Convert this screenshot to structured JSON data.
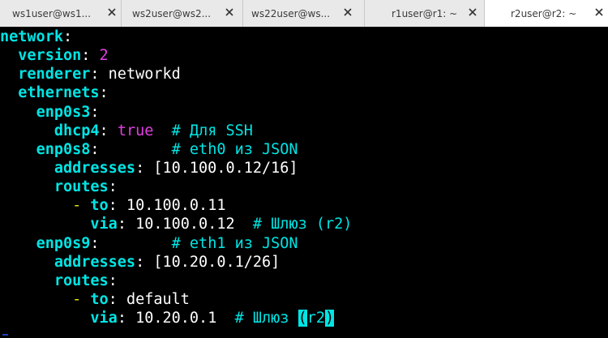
{
  "tabs": [
    {
      "label": "ws1user@ws1...",
      "close_icon": "close-icon"
    },
    {
      "label": "ws2user@ws2...",
      "close_icon": "close-icon"
    },
    {
      "label": "ws22user@ws...",
      "close_icon": "close-icon"
    },
    {
      "label": "r1user@r1: ~",
      "close_icon": "close-icon"
    },
    {
      "label": "r2user@r2: ~",
      "close_icon": "close-icon",
      "active": true
    }
  ],
  "terminal": {
    "lines": [
      [
        {
          "t": "network",
          "c": "k"
        },
        {
          "t": ":",
          "c": "p"
        }
      ],
      [
        {
          "t": "  ",
          "c": "p"
        },
        {
          "t": "version",
          "c": "k"
        },
        {
          "t": ": ",
          "c": "p"
        },
        {
          "t": "2",
          "c": "n"
        }
      ],
      [
        {
          "t": "  ",
          "c": "p"
        },
        {
          "t": "renderer",
          "c": "k"
        },
        {
          "t": ": networkd",
          "c": "p"
        }
      ],
      [
        {
          "t": "  ",
          "c": "p"
        },
        {
          "t": "ethernets",
          "c": "k"
        },
        {
          "t": ":",
          "c": "p"
        }
      ],
      [
        {
          "t": "    ",
          "c": "p"
        },
        {
          "t": "enp0s3",
          "c": "k"
        },
        {
          "t": ":",
          "c": "p"
        }
      ],
      [
        {
          "t": "      ",
          "c": "p"
        },
        {
          "t": "dhcp4",
          "c": "k"
        },
        {
          "t": ": ",
          "c": "p"
        },
        {
          "t": "true",
          "c": "n"
        },
        {
          "t": "  # Для SSH",
          "c": "c"
        }
      ],
      [
        {
          "t": "    ",
          "c": "p"
        },
        {
          "t": "enp0s8",
          "c": "k"
        },
        {
          "t": ":        ",
          "c": "p"
        },
        {
          "t": "# eth0 из JSON",
          "c": "c"
        }
      ],
      [
        {
          "t": "      ",
          "c": "p"
        },
        {
          "t": "addresses",
          "c": "k"
        },
        {
          "t": ": [10.100.0.12/16]",
          "c": "p"
        }
      ],
      [
        {
          "t": "      ",
          "c": "p"
        },
        {
          "t": "routes",
          "c": "k"
        },
        {
          "t": ":",
          "c": "p"
        }
      ],
      [
        {
          "t": "        ",
          "c": "p"
        },
        {
          "t": "- ",
          "c": "d"
        },
        {
          "t": "to",
          "c": "k"
        },
        {
          "t": ": 10.100.0.11",
          "c": "p"
        }
      ],
      [
        {
          "t": "          ",
          "c": "p"
        },
        {
          "t": "via",
          "c": "k"
        },
        {
          "t": ": 10.100.0.12  ",
          "c": "p"
        },
        {
          "t": "# Шлюз (r2)",
          "c": "c"
        }
      ],
      [
        {
          "t": "    ",
          "c": "p"
        },
        {
          "t": "enp0s9",
          "c": "k"
        },
        {
          "t": ":        ",
          "c": "p"
        },
        {
          "t": "# eth1 из JSON",
          "c": "c"
        }
      ],
      [
        {
          "t": "      ",
          "c": "p"
        },
        {
          "t": "addresses",
          "c": "k"
        },
        {
          "t": ": [10.20.0.1/26]",
          "c": "p"
        }
      ],
      [
        {
          "t": "      ",
          "c": "p"
        },
        {
          "t": "routes",
          "c": "k"
        },
        {
          "t": ":",
          "c": "p"
        }
      ],
      [
        {
          "t": "        ",
          "c": "p"
        },
        {
          "t": "- ",
          "c": "d"
        },
        {
          "t": "to",
          "c": "k"
        },
        {
          "t": ": default",
          "c": "p"
        }
      ],
      [
        {
          "t": "          ",
          "c": "p"
        },
        {
          "t": "via",
          "c": "k"
        },
        {
          "t": ": 10.20.0.1  ",
          "c": "p"
        },
        {
          "t": "# Шлюз ",
          "c": "c"
        },
        {
          "t": "(",
          "c": "cursor"
        },
        {
          "t": "r2",
          "c": "c"
        },
        {
          "t": ")",
          "c": "cursor"
        }
      ]
    ]
  },
  "colors": {
    "key": "#00e5e5",
    "number": "#e040e0",
    "comment": "#00e5e5",
    "dash": "#e5e500",
    "text": "#ffffff",
    "background": "#000000",
    "tabbar": "#e9e9e9",
    "active_tab": "#ffffff"
  }
}
